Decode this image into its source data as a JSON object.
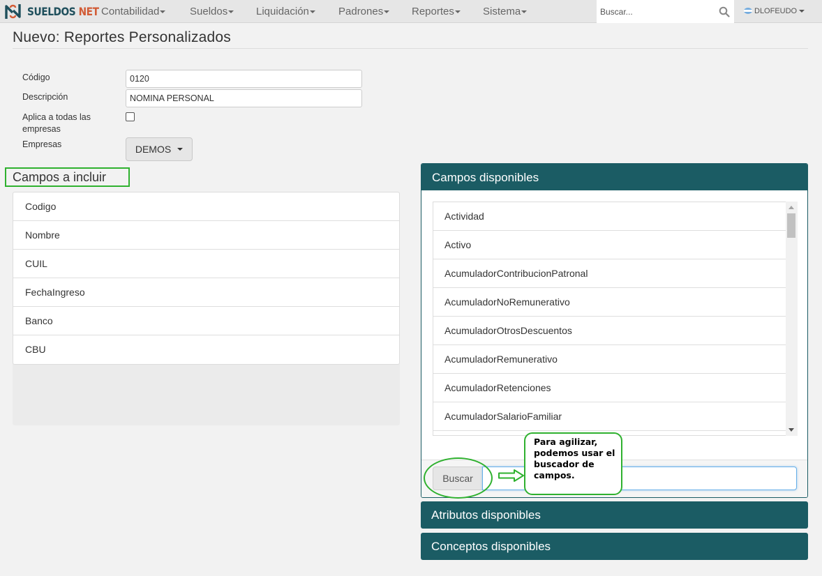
{
  "navbar": {
    "brand_primary": "SUELDOS",
    "brand_secondary": "NET",
    "menus": [
      "Contabilidad",
      "Sueldos",
      "Liquidación",
      "Padrones",
      "Reportes",
      "Sistema"
    ],
    "search_placeholder": "Buscar...",
    "user": "DLOFEUDO"
  },
  "page": {
    "title": "Nuevo: Reportes Personalizados"
  },
  "form": {
    "codigo_label": "Código",
    "codigo_value": "0120",
    "descripcion_label": "Descripción",
    "descripcion_value": "NOMINA PERSONAL",
    "aplica_label": "Aplica a todas las empresas",
    "aplica_checked": false,
    "empresas_label": "Empresas",
    "empresas_value": "DEMOS"
  },
  "campos_incluir": {
    "title": "Campos a incluir",
    "items": [
      "Codigo",
      "Nombre",
      "CUIL",
      "FechaIngreso",
      "Banco",
      "CBU"
    ]
  },
  "campos_disponibles": {
    "title": "Campos disponibles",
    "items": [
      "Actividad",
      "Activo",
      "AcumuladorContribucionPatronal",
      "AcumuladorNoRemunerativo",
      "AcumuladorOtrosDescuentos",
      "AcumuladorRemunerativo",
      "AcumuladorRetenciones",
      "AcumuladorSalarioFamiliar"
    ],
    "search_button": "Buscar"
  },
  "atributos_disponibles": {
    "title": "Atributos disponibles"
  },
  "conceptos_disponibles": {
    "title": "Conceptos disponibles"
  },
  "annotation": {
    "note": "Para agilizar, podemos usar el buscador de campos."
  },
  "colors": {
    "navbar_bg": "#e6e6e6",
    "panel_header": "#1b5c64",
    "annotation_green": "#2fb12f",
    "brand_dark": "#1f4f5c",
    "brand_orange": "#d25b35"
  }
}
